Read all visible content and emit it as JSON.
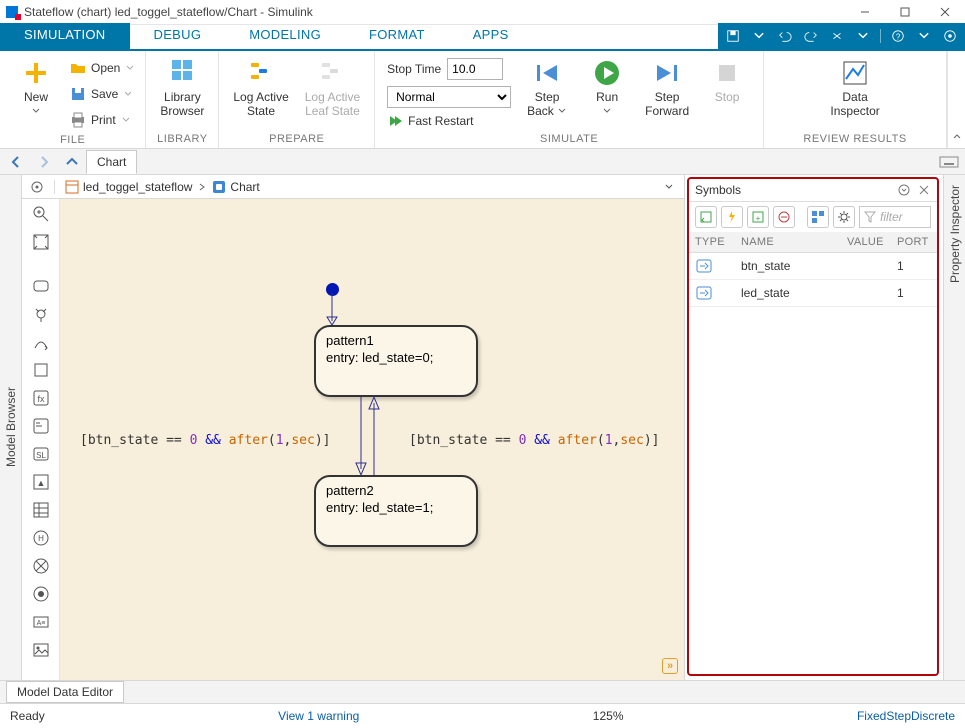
{
  "title": "Stateflow (chart) led_toggel_stateflow/Chart - Simulink",
  "tabs": [
    "SIMULATION",
    "DEBUG",
    "MODELING",
    "FORMAT",
    "APPS"
  ],
  "activeTab": "SIMULATION",
  "ribbon": {
    "file": {
      "new": "New",
      "open": "Open",
      "save": "Save",
      "print": "Print",
      "group": "FILE"
    },
    "library": {
      "library": "Library",
      "browser": "Browser",
      "group": "LIBRARY"
    },
    "prepare": {
      "logActive": "Log Active",
      "state": "State",
      "logLeaf": "Log Active",
      "leaf": "Leaf State",
      "group": "PREPARE"
    },
    "simulate": {
      "stopTime": "Stop Time",
      "stopTimeVal": "10.0",
      "mode": "Normal",
      "fastRestart": "Fast Restart",
      "stepBack": "Step\nBack",
      "run": "Run",
      "stepFwd": "Step\nForward",
      "stop": "Stop",
      "group": "SIMULATE"
    },
    "review": {
      "data": "Data",
      "inspector": "Inspector",
      "group": "REVIEW RESULTS"
    }
  },
  "sidebars": {
    "left": "Model Browser",
    "right": "Property Inspector"
  },
  "nav": {
    "tab": "Chart"
  },
  "breadcrumb": {
    "root": "led_toggel_stateflow",
    "leaf": "Chart"
  },
  "chart": {
    "state1": {
      "name": "pattern1",
      "entry": "entry: led_state=0;"
    },
    "state2": {
      "name": "pattern2",
      "entry": "entry: led_state=1;"
    },
    "cond": {
      "a": "[btn_state == ",
      "b": "0 ",
      "c": "&& ",
      "d": "after",
      "e": "(",
      "f": "1",
      "g": ",",
      "h": "sec",
      "i": ")]"
    }
  },
  "panel": {
    "title": "Symbols",
    "filter": "filter",
    "cols": [
      "TYPE",
      "NAME",
      "VALUE",
      "PORT"
    ],
    "rows": [
      {
        "name": "btn_state",
        "value": "",
        "port": "1"
      },
      {
        "name": "led_state",
        "value": "",
        "port": "1"
      }
    ]
  },
  "mde": "Model Data Editor",
  "status": {
    "ready": "Ready",
    "warn": "View 1 warning",
    "zoom": "125%",
    "solver": "FixedStepDiscrete"
  }
}
